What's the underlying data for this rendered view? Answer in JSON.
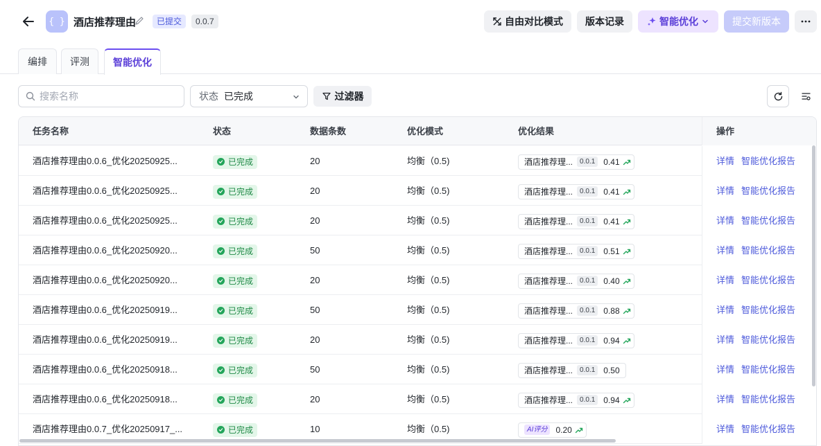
{
  "header": {
    "back_label": "",
    "app_icon_glyph": "{ }",
    "title": "酒店推荐理由",
    "submitted_badge": "已提交",
    "version_badge": "0.0.7",
    "buttons": {
      "compare": "自由对比模式",
      "history": "版本记录",
      "optimize": "智能优化",
      "submit": "提交新版本"
    }
  },
  "tabs": [
    {
      "label": "编排"
    },
    {
      "label": "评测"
    },
    {
      "label": "智能优化"
    }
  ],
  "filters": {
    "search_placeholder": "搜索名称",
    "status_label": "状态",
    "status_value": "已完成",
    "filter_button": "过滤器"
  },
  "table": {
    "columns": {
      "name": "任务名称",
      "status": "状态",
      "count": "数据条数",
      "mode": "优化模式",
      "result": "优化结果",
      "ops": "操作"
    },
    "rows": [
      {
        "name": "酒店推荐理由0.0.6_优化20250925...",
        "status": "已完成",
        "count": "20",
        "mode": "均衡（0.5)",
        "result_name": "酒店推荐理...",
        "result_version": "0.0.1",
        "score": "0.41",
        "trend": true,
        "ai": false,
        "detail": "详情",
        "report": "智能优化报告"
      },
      {
        "name": "酒店推荐理由0.0.6_优化20250925...",
        "status": "已完成",
        "count": "20",
        "mode": "均衡（0.5)",
        "result_name": "酒店推荐理...",
        "result_version": "0.0.1",
        "score": "0.41",
        "trend": true,
        "ai": false,
        "detail": "详情",
        "report": "智能优化报告"
      },
      {
        "name": "酒店推荐理由0.0.6_优化20250925...",
        "status": "已完成",
        "count": "20",
        "mode": "均衡（0.5)",
        "result_name": "酒店推荐理...",
        "result_version": "0.0.1",
        "score": "0.41",
        "trend": true,
        "ai": false,
        "detail": "详情",
        "report": "智能优化报告"
      },
      {
        "name": "酒店推荐理由0.0.6_优化20250920...",
        "status": "已完成",
        "count": "50",
        "mode": "均衡（0.5)",
        "result_name": "酒店推荐理...",
        "result_version": "0.0.1",
        "score": "0.51",
        "trend": true,
        "ai": false,
        "detail": "详情",
        "report": "智能优化报告"
      },
      {
        "name": "酒店推荐理由0.0.6_优化20250920...",
        "status": "已完成",
        "count": "20",
        "mode": "均衡（0.5)",
        "result_name": "酒店推荐理...",
        "result_version": "0.0.1",
        "score": "0.40",
        "trend": true,
        "ai": false,
        "detail": "详情",
        "report": "智能优化报告"
      },
      {
        "name": "酒店推荐理由0.0.6_优化20250919...",
        "status": "已完成",
        "count": "50",
        "mode": "均衡（0.5)",
        "result_name": "酒店推荐理...",
        "result_version": "0.0.1",
        "score": "0.88",
        "trend": true,
        "ai": false,
        "detail": "详情",
        "report": "智能优化报告"
      },
      {
        "name": "酒店推荐理由0.0.6_优化20250919...",
        "status": "已完成",
        "count": "20",
        "mode": "均衡（0.5)",
        "result_name": "酒店推荐理...",
        "result_version": "0.0.1",
        "score": "0.94",
        "trend": true,
        "ai": false,
        "detail": "详情",
        "report": "智能优化报告"
      },
      {
        "name": "酒店推荐理由0.0.6_优化20250918...",
        "status": "已完成",
        "count": "50",
        "mode": "均衡（0.5)",
        "result_name": "酒店推荐理...",
        "result_version": "0.0.1",
        "score": "0.50",
        "trend": false,
        "ai": false,
        "detail": "详情",
        "report": "智能优化报告"
      },
      {
        "name": "酒店推荐理由0.0.6_优化20250918...",
        "status": "已完成",
        "count": "20",
        "mode": "均衡（0.5)",
        "result_name": "酒店推荐理...",
        "result_version": "0.0.1",
        "score": "0.94",
        "trend": true,
        "ai": false,
        "detail": "详情",
        "report": "智能优化报告"
      },
      {
        "name": "酒店推荐理由0.0.7_优化20250917_...",
        "status": "已完成",
        "count": "10",
        "mode": "均衡（0.5)",
        "result_name": "",
        "result_version": "",
        "ai_label": "AI评分",
        "score": "0.20",
        "trend": true,
        "ai": true,
        "detail": "详情",
        "report": "智能优化报告"
      }
    ]
  },
  "colors": {
    "accent": "#5b3fd8",
    "link": "#4e5bdb",
    "success": "#23a55a"
  }
}
